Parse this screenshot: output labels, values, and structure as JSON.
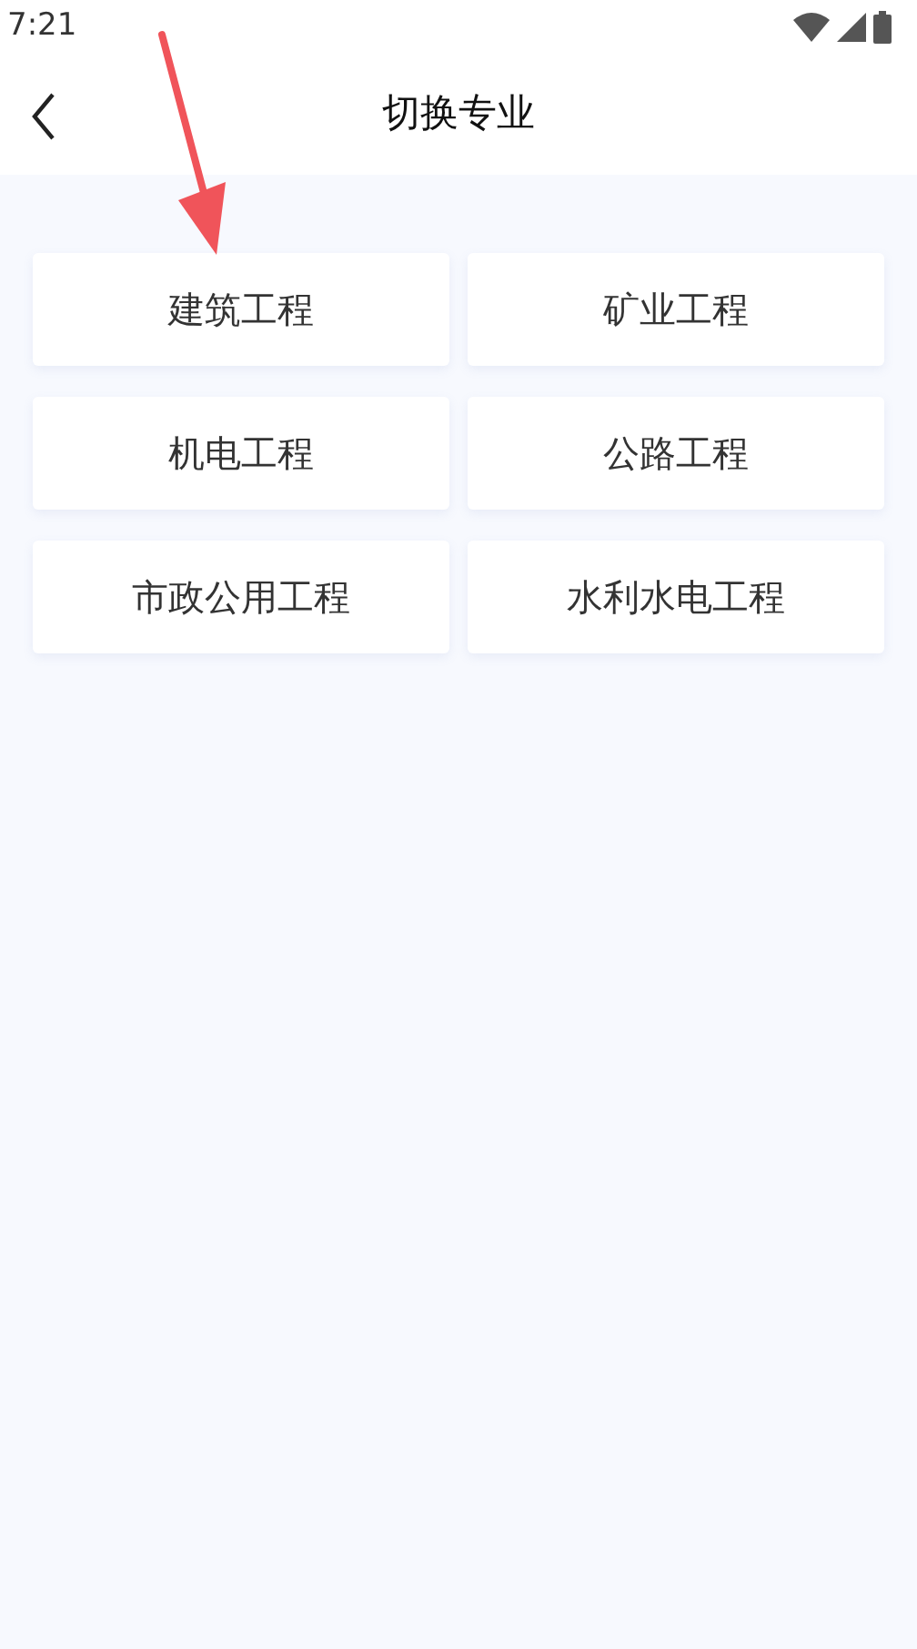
{
  "status_bar": {
    "time": "7:21"
  },
  "header": {
    "title": "切换专业"
  },
  "majors": [
    {
      "label": "建筑工程"
    },
    {
      "label": "矿业工程"
    },
    {
      "label": "机电工程"
    },
    {
      "label": "公路工程"
    },
    {
      "label": "市政公用工程"
    },
    {
      "label": "水利水电工程"
    }
  ]
}
